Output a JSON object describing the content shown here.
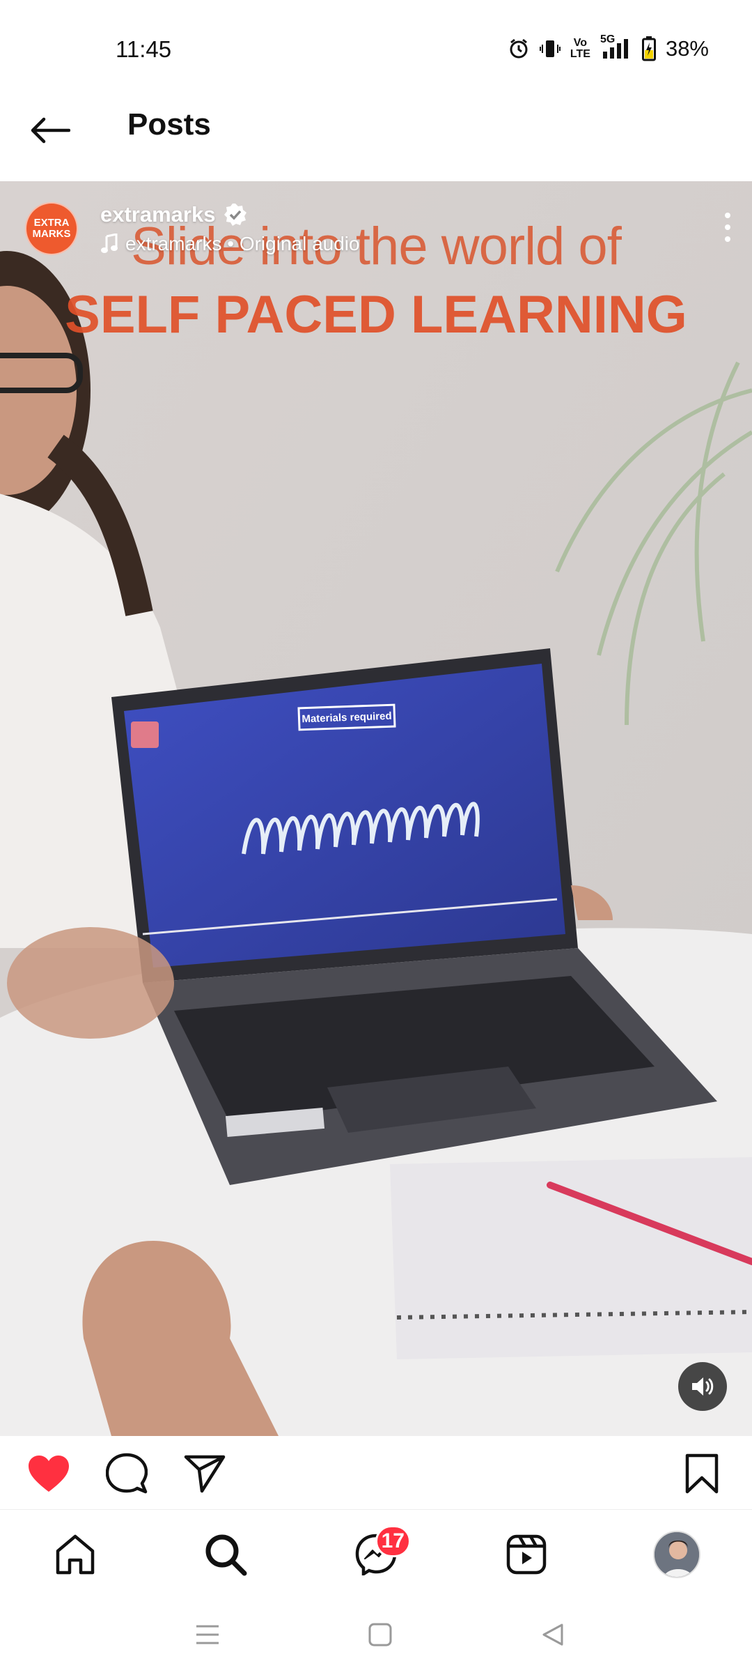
{
  "status_bar": {
    "time": "11:45",
    "network_label_top": "Vo",
    "network_label_bottom": "LTE",
    "network_type": "5G",
    "battery": "38%"
  },
  "header": {
    "title": "Posts",
    "back_icon": "arrow-left-icon"
  },
  "post": {
    "username": "extramarks",
    "verified": true,
    "audio": "extramarks • Original audio",
    "avatar_logo_line1": "EXTRA",
    "avatar_logo_line2": "MARKS",
    "overlay_line1": "Slide into the world of",
    "overlay_line2": "SELF PACED LEARNING",
    "screen_label": "Materials required",
    "sound": "on"
  },
  "actions": {
    "like_icon": "heart-filled-icon",
    "liked": true,
    "comment_icon": "comment-icon",
    "share_icon": "send-icon",
    "save_icon": "bookmark-icon"
  },
  "bottom_nav": {
    "items": [
      "home-icon",
      "search-icon",
      "messenger-icon",
      "reels-icon",
      "profile-avatar"
    ],
    "messenger_badge": "17"
  },
  "system_nav": [
    "menu-icon",
    "home-square-icon",
    "back-triangle-icon"
  ],
  "colors": {
    "like_red": "#ff3040",
    "badge_red": "#ff3040",
    "brand_orange": "#ee5a2e"
  }
}
